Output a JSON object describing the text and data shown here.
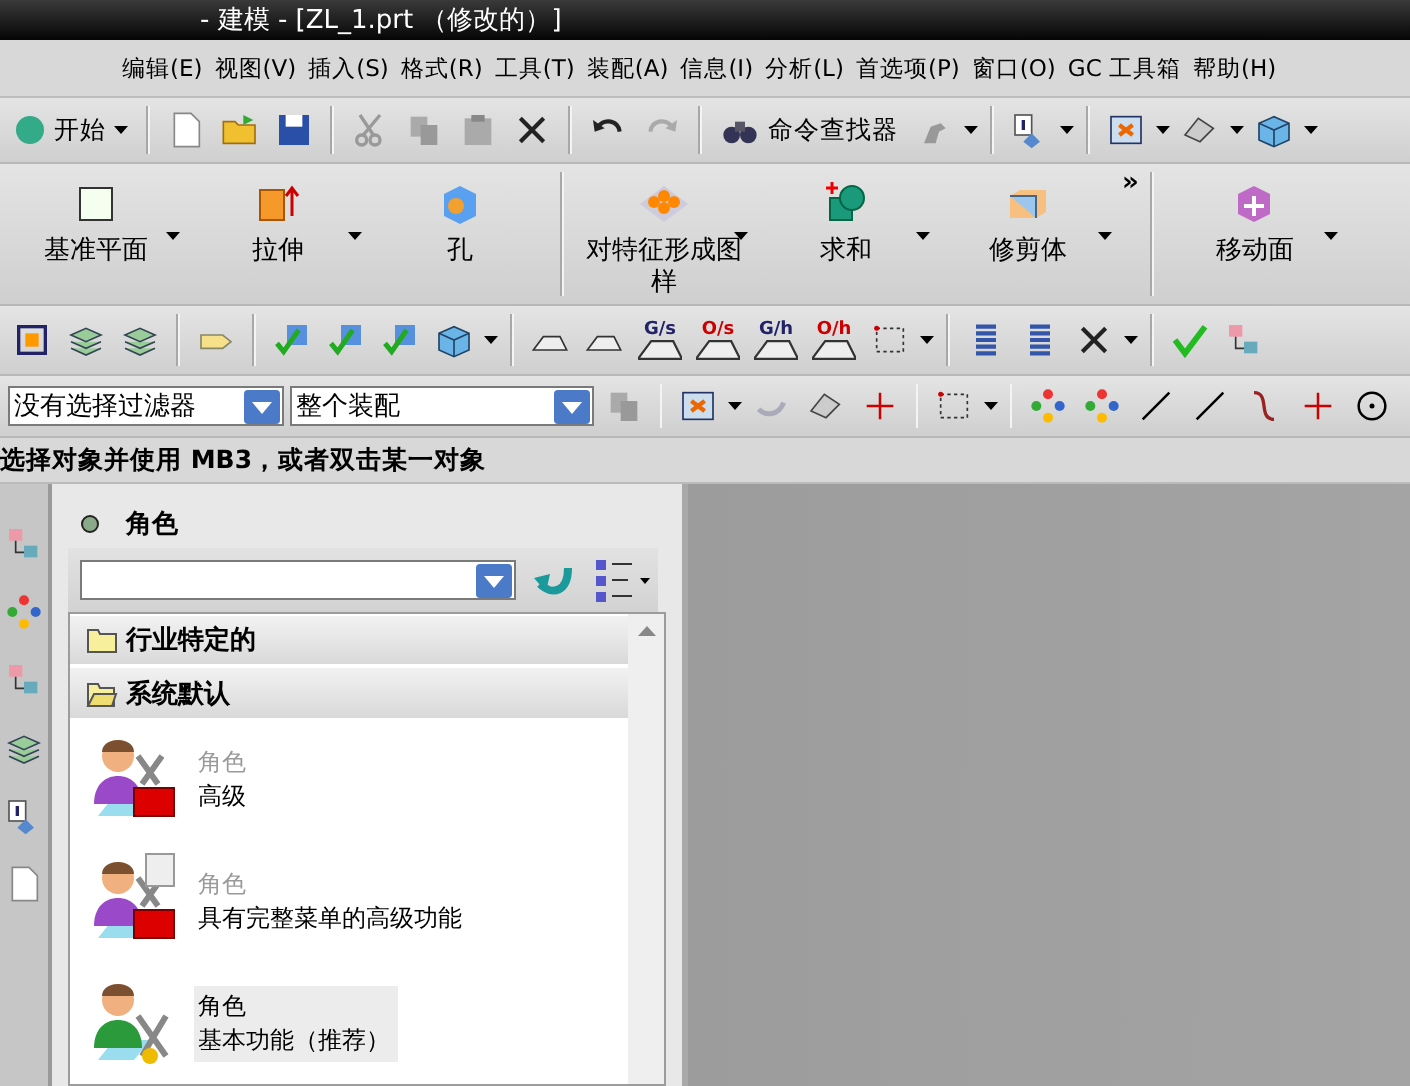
{
  "window": {
    "title": "- 建模 - [ZL_1.prt （修改的）]"
  },
  "menu": [
    {
      "label": "编辑(E)"
    },
    {
      "label": "视图(V)"
    },
    {
      "label": "插入(S)"
    },
    {
      "label": "格式(R)"
    },
    {
      "label": "工具(T)"
    },
    {
      "label": "装配(A)"
    },
    {
      "label": "信息(I)"
    },
    {
      "label": "分析(L)"
    },
    {
      "label": "首选项(P)"
    },
    {
      "label": "窗口(O)"
    },
    {
      "label": "GC 工具箱"
    },
    {
      "label": "帮助(H)"
    }
  ],
  "standard_toolbar": {
    "start": "开始",
    "command_finder": "命令查找器"
  },
  "feature_toolbar": {
    "more": "»",
    "items": [
      {
        "label": "基准平面",
        "dropdown": true
      },
      {
        "label": "拉伸",
        "dropdown": true
      },
      {
        "label": "孔",
        "dropdown": false
      },
      {
        "label": "对特征形成图样",
        "dropdown": true
      },
      {
        "label": "求和",
        "dropdown": true
      },
      {
        "label": "修剪体",
        "dropdown": true
      },
      {
        "label": "移动面",
        "dropdown": true
      }
    ]
  },
  "curve_toolbar": {
    "labels": [
      "G/s",
      "O/s",
      "G/h",
      "O/h"
    ]
  },
  "selection_bar": {
    "filter": "没有选择过滤器",
    "scope": "整个装配"
  },
  "prompt": "选择对象并使用 MB3，或者双击某一对象",
  "roles_panel": {
    "title": "角色",
    "groups": [
      {
        "label": "行业特定的",
        "expanded": false
      },
      {
        "label": "系统默认",
        "expanded": true
      }
    ],
    "roles": [
      {
        "type": "角色",
        "name": "高级",
        "selected": false
      },
      {
        "type": "角色",
        "name": "具有完整菜单的高级功能",
        "selected": false
      },
      {
        "type": "角色",
        "name": "基本功能（推荐）",
        "selected": true
      }
    ]
  }
}
